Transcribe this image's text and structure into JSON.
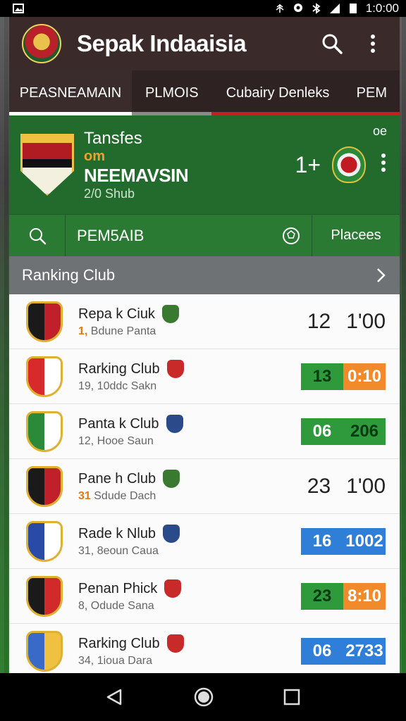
{
  "status_bar": {
    "time": "1:0:00"
  },
  "app_bar": {
    "title": "Sepak Indaaisia"
  },
  "tabs": [
    {
      "label": "PEASNEAMAIN"
    },
    {
      "label": "PLMOIS"
    },
    {
      "label": "Cubairy Denleks"
    },
    {
      "label": "PEM"
    }
  ],
  "match_card": {
    "title": "Tansfes",
    "sub": "om",
    "team": "NEEMAVSIN",
    "meta": "2/0 Shub",
    "score": "1+",
    "badge": "oe"
  },
  "action_bar": {
    "label": "PEM5AIB",
    "places": "Placees"
  },
  "section": {
    "title": "Ranking Club"
  },
  "clubs": [
    {
      "name": "Repa k Ciuk",
      "sub_prefix": "1,",
      "sub": "Bdune Panta",
      "stat_a": "12",
      "stat_b": "1'00",
      "style": "plain",
      "crest": "#1a1a1a",
      "crest2": "#c0202a",
      "badge": "#3a7a30"
    },
    {
      "name": "Rarking Club",
      "sub_prefix": "",
      "sub": "19, 10ddc Sakn",
      "stat_a": "13",
      "stat_b": "0:10",
      "style": "green-orange",
      "crest": "#d82a2a",
      "crest2": "#ffffff",
      "badge": "#c82a2a"
    },
    {
      "name": "Panta k Club",
      "sub_prefix": "",
      "sub": "12, Hooe Saun",
      "stat_a": "06",
      "stat_b": "206",
      "style": "green-green",
      "crest": "#2a8a3a",
      "crest2": "#ffffff",
      "badge": "#2a4a8a"
    },
    {
      "name": "Pane h Club",
      "sub_prefix": "31",
      "sub": "Sdude Dach",
      "stat_a": "23",
      "stat_b": "1'00",
      "style": "plain",
      "crest": "#1a1a1a",
      "crest2": "#c0202a",
      "badge": "#3a7a30"
    },
    {
      "name": "Rade k Nlub",
      "sub_prefix": "",
      "sub": "31, 8eoun Caua",
      "stat_a": "16",
      "stat_b": "1002",
      "style": "blue",
      "crest": "#2a4aa8",
      "crest2": "#ffffff",
      "badge": "#2a4a8a"
    },
    {
      "name": "Penan Phick",
      "sub_prefix": "",
      "sub": "8, Odude Sana",
      "stat_a": "23",
      "stat_b": "8:10",
      "style": "green-orange",
      "crest": "#1a1a1a",
      "crest2": "#d02a2a",
      "badge": "#c82a2a"
    },
    {
      "name": "Rarking Club",
      "sub_prefix": "",
      "sub": "34, 1ioua Dara",
      "stat_a": "06",
      "stat_b": "2733",
      "style": "blue",
      "crest": "#3a6ac8",
      "crest2": "#f0c040",
      "badge": "#c82a2a"
    }
  ],
  "colors": {
    "app_bar": "#3a2a2a",
    "match_card": "#226b2c",
    "section_header": "#6f7275",
    "green": "#2f9a3c",
    "orange": "#f08a2a",
    "blue": "#2f7fd8"
  }
}
